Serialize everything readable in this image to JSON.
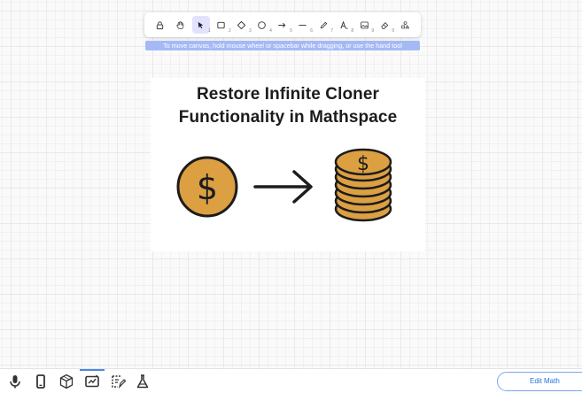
{
  "toolbar": {
    "tools": [
      {
        "name": "lock",
        "key": ""
      },
      {
        "name": "hand",
        "key": ""
      },
      {
        "name": "selection",
        "key": "1"
      },
      {
        "name": "rectangle",
        "key": "2"
      },
      {
        "name": "diamond",
        "key": "3"
      },
      {
        "name": "ellipse",
        "key": "4"
      },
      {
        "name": "arrow",
        "key": "5"
      },
      {
        "name": "line",
        "key": "6"
      },
      {
        "name": "draw",
        "key": "7"
      },
      {
        "name": "text",
        "key": "8"
      },
      {
        "name": "image",
        "key": "9"
      },
      {
        "name": "eraser",
        "key": "0"
      },
      {
        "name": "more-tools",
        "key": ""
      }
    ],
    "hint": "To move canvas, hold mouse wheel or spacebar while dragging, or use the hand tool"
  },
  "card": {
    "title_line1": "Restore Infinite Cloner",
    "title_line2": "Functionality in Mathspace",
    "coin_symbol": "$",
    "coin_color": "#dca042"
  },
  "bottom_bar": {
    "icons": [
      "microphone-icon",
      "phone-icon",
      "cube-icon",
      "whiteboard-icon",
      "worked-solution-icon",
      "lab-flask-icon"
    ],
    "edit_math_label": "Edit Math"
  },
  "colors": {
    "accent": "#4b86e6",
    "hint_bg": "#a5b9f5",
    "active_tool_bg": "#e3e2fe"
  }
}
